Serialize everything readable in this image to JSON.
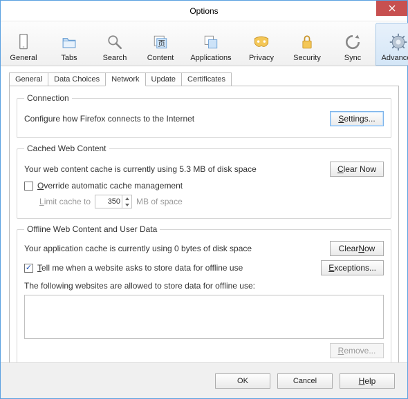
{
  "window": {
    "title": "Options"
  },
  "toolbar": {
    "items": [
      {
        "label": "General"
      },
      {
        "label": "Tabs"
      },
      {
        "label": "Search"
      },
      {
        "label": "Content"
      },
      {
        "label": "Applications"
      },
      {
        "label": "Privacy"
      },
      {
        "label": "Security"
      },
      {
        "label": "Sync"
      },
      {
        "label": "Advanced"
      }
    ],
    "selected": "Advanced"
  },
  "tabs": {
    "items": [
      "General",
      "Data Choices",
      "Network",
      "Update",
      "Certificates"
    ],
    "active": "Network"
  },
  "connection": {
    "legend": "Connection",
    "desc": "Configure how Firefox connects to the Internet",
    "settings_btn": "Settings..."
  },
  "cache": {
    "legend": "Cached Web Content",
    "usage": "Your web content cache is currently using 5.3 MB of disk space",
    "clear_btn": "Clear Now",
    "override_u": "O",
    "override_label": "verride automatic cache management",
    "limit_u": "L",
    "limit_label": "imit cache to",
    "limit_value": "350",
    "limit_unit": "MB of space"
  },
  "offline": {
    "legend": "Offline Web Content and User Data",
    "usage": "Your application cache is currently using 0 bytes of disk space",
    "clear_btn_pre": "Clear ",
    "clear_btn_u": "N",
    "clear_btn_post": "ow",
    "tell_u": "T",
    "tell_label": "ell me when a website asks to store data for offline use",
    "exceptions_u": "E",
    "exceptions_label": "xceptions...",
    "following": "The following websites are allowed to store data for offline use:",
    "remove_u": "R",
    "remove_label": "emove..."
  },
  "footer": {
    "ok": "OK",
    "cancel": "Cancel",
    "help_u": "H",
    "help_label": "elp"
  }
}
